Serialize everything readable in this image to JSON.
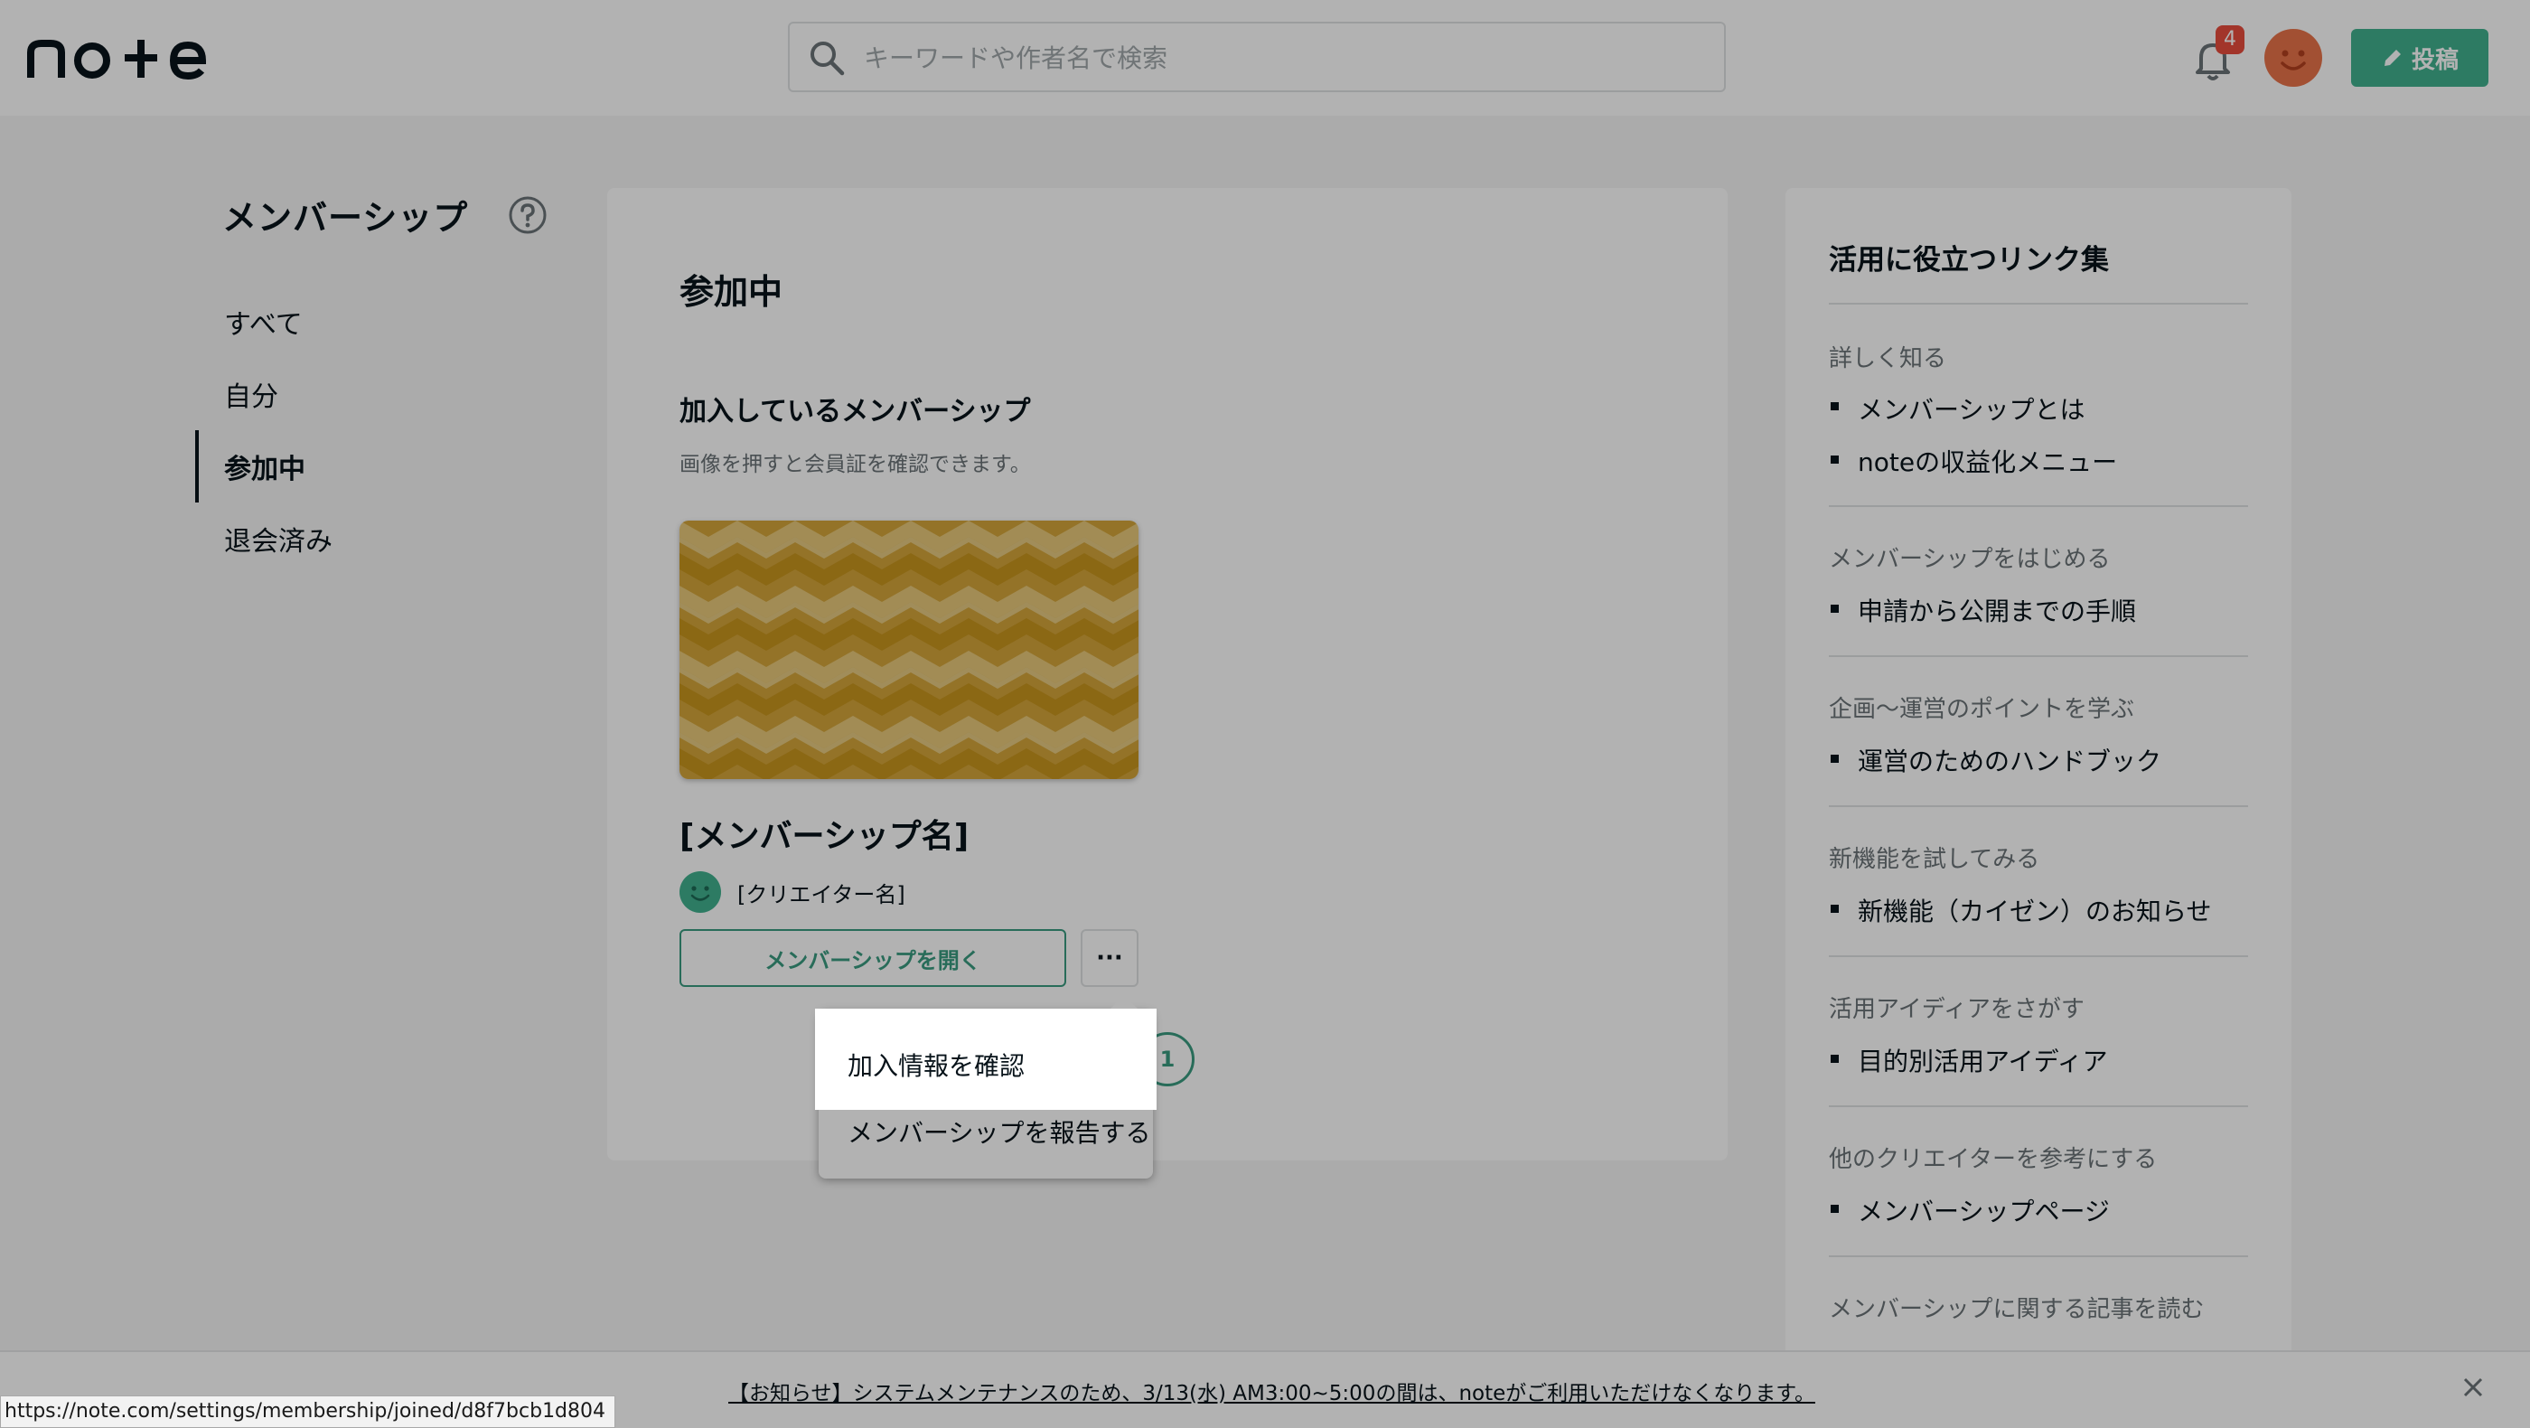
{
  "header": {
    "logo_text": "note",
    "search_placeholder": "キーワードや作者名で検索",
    "notification_count": "4",
    "post_button_label": "投稿"
  },
  "sidebar": {
    "title": "メンバーシップ",
    "items": [
      {
        "label": "すべて"
      },
      {
        "label": "自分"
      },
      {
        "label": "参加中"
      },
      {
        "label": "退会済み"
      }
    ],
    "active_index": 2
  },
  "main": {
    "title": "参加中",
    "section_title": "加入しているメンバーシップ",
    "section_desc": "画像を押すと会員証を確認できます。",
    "membership_name": "[メンバーシップ名]",
    "creator_name": "[クリエイター名]",
    "open_button": "メンバーシップを開く",
    "more_button": "···",
    "pager_current": "1"
  },
  "dropdown": {
    "items": [
      {
        "label": "加入情報を確認"
      },
      {
        "label": "メンバーシップを報告する"
      }
    ]
  },
  "links": {
    "title": "活用に役立つリンク集",
    "groups": [
      {
        "heading": "詳しく知る",
        "links": [
          "メンバーシップとは",
          "noteの収益化メニュー"
        ]
      },
      {
        "heading": "メンバーシップをはじめる",
        "links": [
          "申請から公開までの手順"
        ]
      },
      {
        "heading": "企画〜運営のポイントを学ぶ",
        "links": [
          "運営のためのハンドブック"
        ]
      },
      {
        "heading": "新機能を試してみる",
        "links": [
          "新機能（カイゼン）のお知らせ"
        ]
      },
      {
        "heading": "活用アイディアをさがす",
        "links": [
          "目的別活用アイディア"
        ]
      },
      {
        "heading": "他のクリエイターを参考にする",
        "links": [
          "メンバーシップページ"
        ]
      },
      {
        "heading": "メンバーシップに関する記事を読む",
        "links": []
      }
    ]
  },
  "notice": {
    "text": "【お知らせ】システムメンテナンスのため、3/13(水) AM3:00~5:00の間は、noteがご利用いただけなくなります。"
  },
  "status_bar": {
    "url": "https://note.com/settings/membership/joined/d8f7bcb1d804"
  },
  "colors": {
    "brand_green": "#41b18f",
    "badge_red": "#e84c3d",
    "avatar_orange": "#e8734a",
    "creator_avatar_green": "#41b18f",
    "pattern_gold": "#d4a53a"
  }
}
